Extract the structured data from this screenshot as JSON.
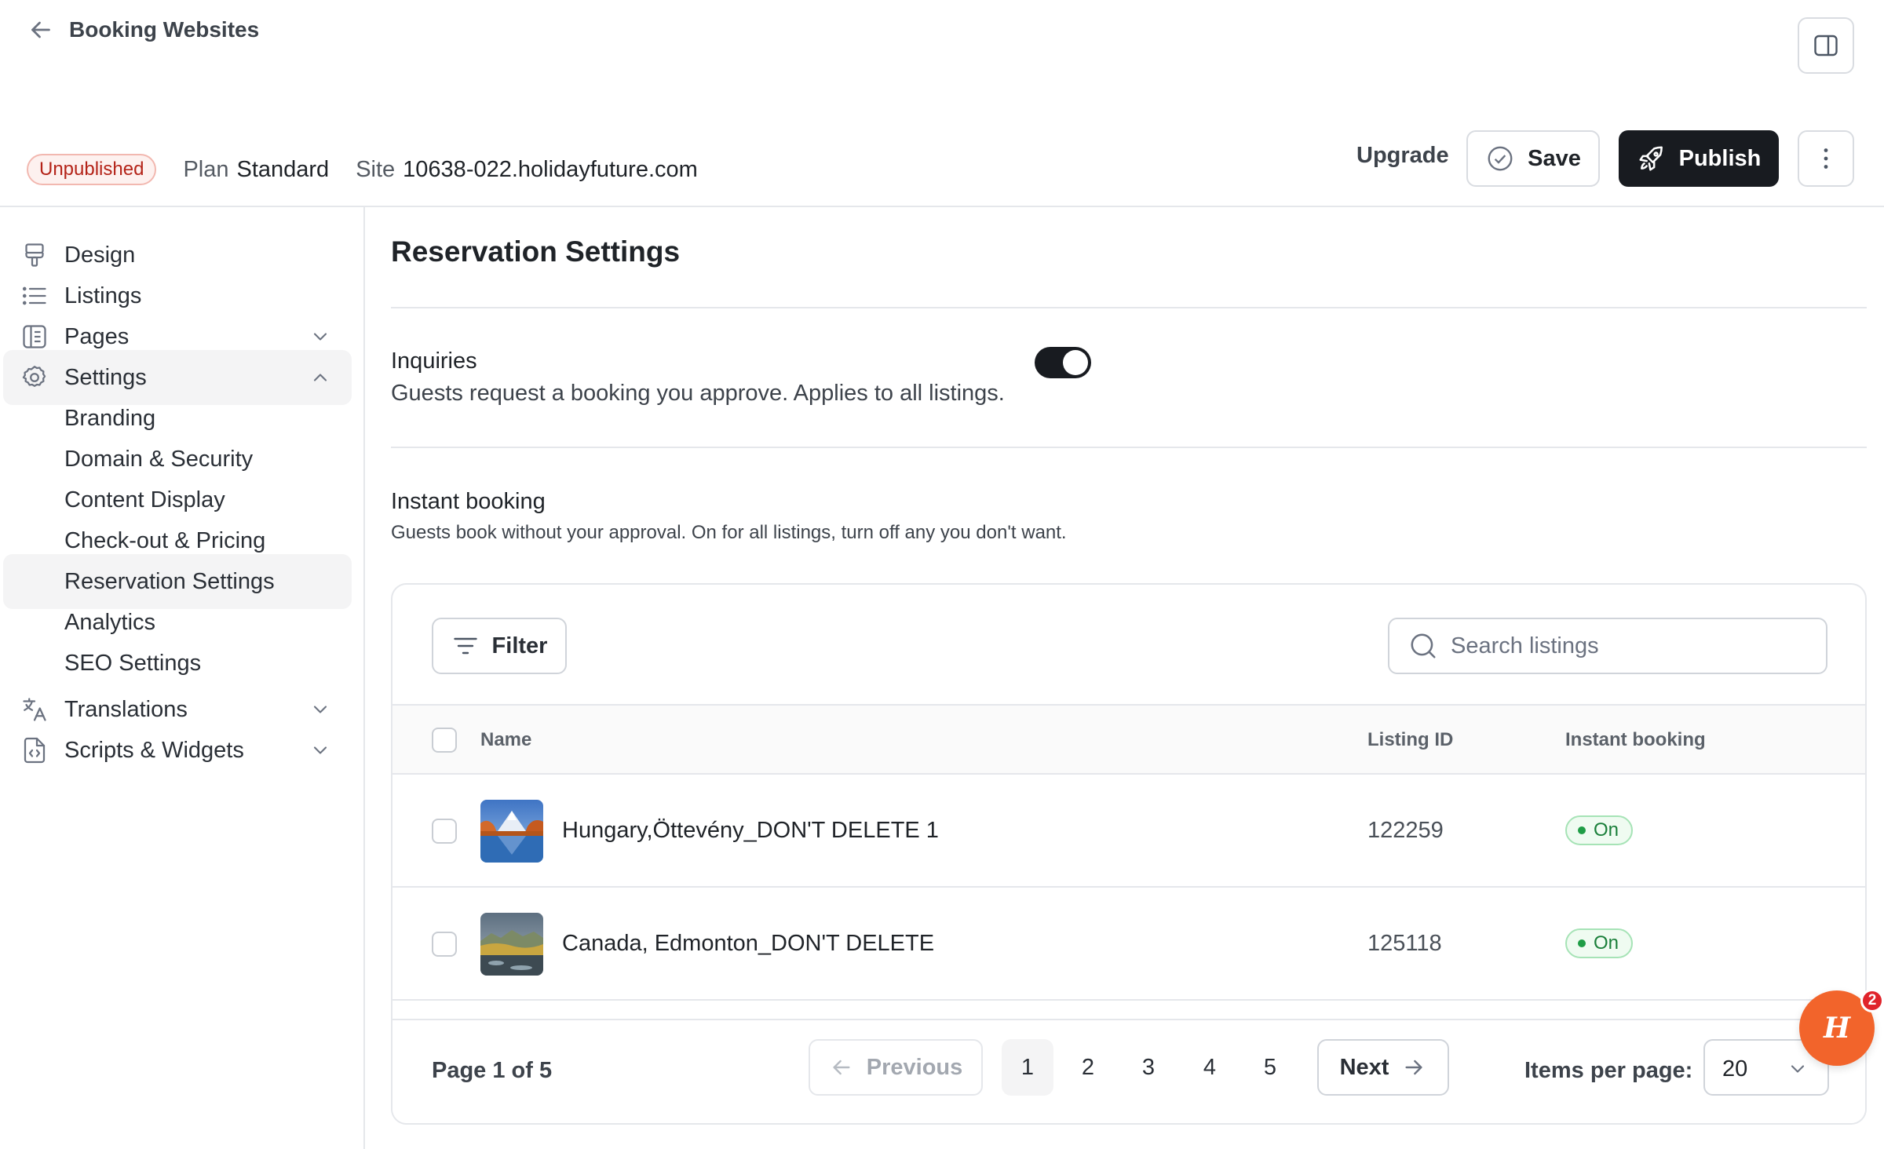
{
  "header": {
    "back_label": "Booking Websites",
    "status_badge": "Unpublished",
    "plan_label": "Plan",
    "plan_value": "Standard",
    "site_label": "Site",
    "site_value": "10638-022.holidayfuture.com",
    "upgrade_label": "Upgrade",
    "save_label": "Save",
    "publish_label": "Publish"
  },
  "sidebar": {
    "items": [
      {
        "label": "Design",
        "icon": "paint-roller-icon"
      },
      {
        "label": "Listings",
        "icon": "list-icon"
      },
      {
        "label": "Pages",
        "icon": "document-icon"
      },
      {
        "label": "Settings",
        "icon": "gear-icon"
      },
      {
        "label": "Translations",
        "icon": "translate-icon"
      },
      {
        "label": "Scripts & Widgets",
        "icon": "code-file-icon"
      }
    ],
    "settings_subitems": [
      "Branding",
      "Domain & Security",
      "Content Display",
      "Check-out & Pricing",
      "Reservation Settings",
      "Analytics",
      "SEO Settings"
    ],
    "active_subitem": "Reservation Settings"
  },
  "main": {
    "title": "Reservation Settings",
    "inquiries": {
      "title": "Inquiries",
      "description": "Guests request a booking you approve. Applies to all listings.",
      "enabled": true
    },
    "instant_booking": {
      "title": "Instant booking",
      "description": "Guests book without your approval. On for all listings, turn off any you don't want."
    },
    "filter_label": "Filter",
    "search_placeholder": "Search listings",
    "table": {
      "columns": [
        "Name",
        "Listing ID",
        "Instant booking"
      ],
      "rows": [
        {
          "name": "Hungary,Öttevény_DON'T DELETE 1",
          "listing_id": "122259",
          "instant_booking": "On"
        },
        {
          "name": "Canada, Edmonton_DON'T DELETE",
          "listing_id": "125118",
          "instant_booking": "On"
        }
      ]
    },
    "pagination": {
      "page_of": "Page 1 of 5",
      "previous_label": "Previous",
      "next_label": "Next",
      "pages": [
        "1",
        "2",
        "3",
        "4",
        "5"
      ],
      "current_page": "1",
      "items_per_page_label": "Items per page:",
      "items_per_page": "20"
    }
  },
  "help_widget": {
    "glyph": "H",
    "notification_count": "2"
  },
  "colors": {
    "primary_dark": "#181b20",
    "unpublished_red": "#b42318",
    "on_green": "#1a7f3a",
    "help_orange": "#f2642b"
  }
}
